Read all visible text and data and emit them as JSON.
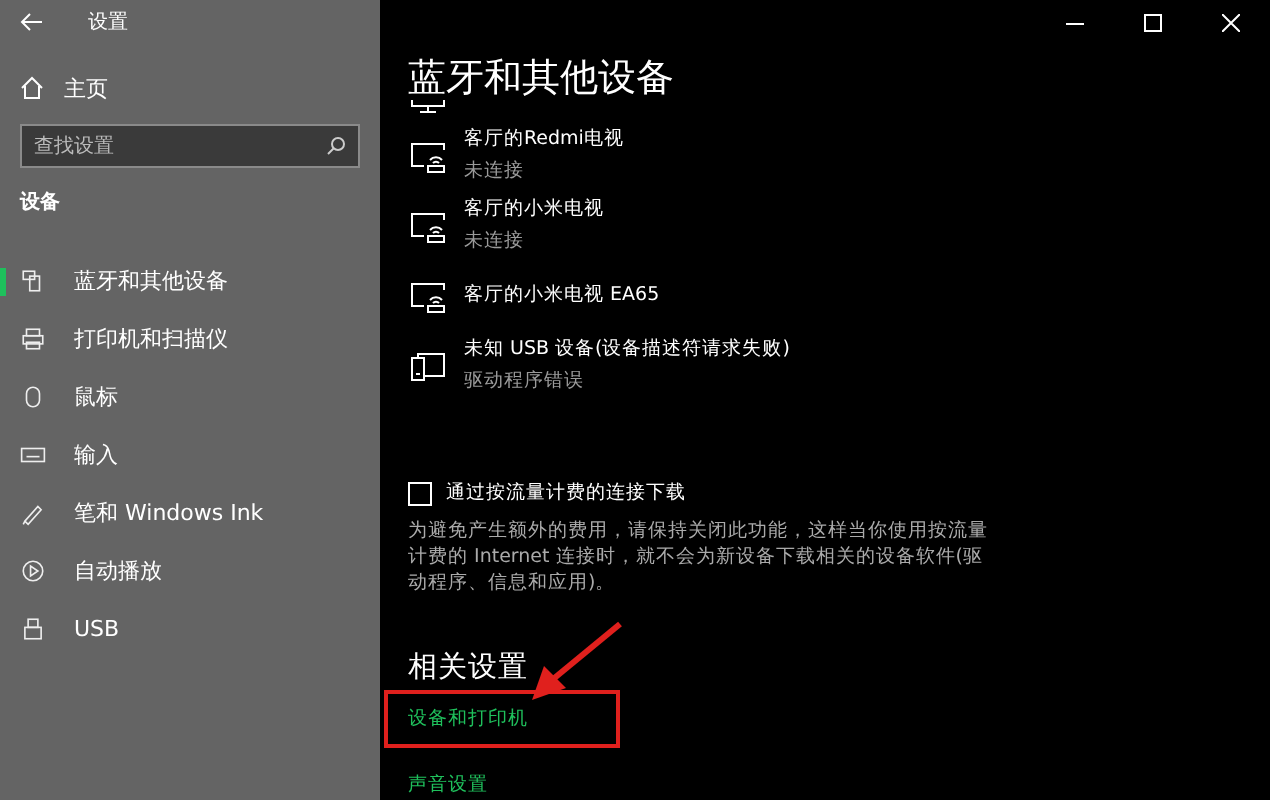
{
  "window": {
    "title": "设置"
  },
  "sidebar": {
    "home": "主页",
    "search": {
      "placeholder": "查找设置"
    },
    "section": "设备",
    "items": [
      {
        "kind": "bluetooth",
        "label": "蓝牙和其他设备",
        "selected": true
      },
      {
        "kind": "printer",
        "label": "打印机和扫描仪",
        "selected": false
      },
      {
        "kind": "mouse",
        "label": "鼠标",
        "selected": false
      },
      {
        "kind": "keyboard",
        "label": "输入",
        "selected": false
      },
      {
        "kind": "pen",
        "label": "笔和 Windows Ink",
        "selected": false
      },
      {
        "kind": "autoplay",
        "label": "自动播放",
        "selected": false
      },
      {
        "kind": "usb",
        "label": "USB",
        "selected": false
      }
    ]
  },
  "main": {
    "title": "蓝牙和其他设备",
    "devices": [
      {
        "kind": "monitor"
      },
      {
        "kind": "cast",
        "name": "客厅的Redmi电视",
        "status": "未连接"
      },
      {
        "kind": "cast",
        "name": "客厅的小米电视",
        "status": "未连接"
      },
      {
        "kind": "cast",
        "name": "客厅的小米电视 EA65"
      },
      {
        "kind": "device",
        "name": "未知 USB 设备(设备描述符请求失败)",
        "status": "驱动程序错误"
      }
    ],
    "metered": {
      "label": "通过按流量计费的连接下载",
      "checked": false,
      "description": "为避免产生额外的费用，请保持关闭此功能，这样当你使用按流量计费的 Internet 连接时，就不会为新设备下载相关的设备软件(驱动程序、信息和应用)。"
    },
    "related": {
      "title": "相关设置",
      "links": [
        {
          "label": "设备和打印机",
          "highlighted": true
        },
        {
          "label": "声音设置",
          "highlighted": false
        }
      ]
    }
  }
}
